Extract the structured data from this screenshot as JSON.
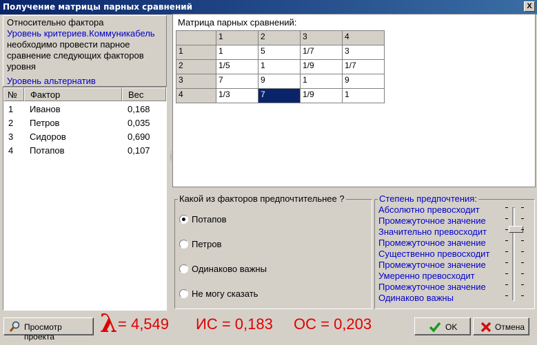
{
  "window": {
    "title": "Получение матрицы парных сравнений",
    "close_glyph": "X"
  },
  "info": {
    "line1": "Относительно фактора",
    "line2": "Уровень критериев.Коммуникабель",
    "line3": "необходимо провести парное",
    "line4": "сравнение следующих факторов",
    "line5": "уровня",
    "line6": "Уровень альтернатив"
  },
  "factors": {
    "headers": {
      "num": "№",
      "name": "Фактор",
      "weight": "Вес"
    },
    "rows": [
      {
        "num": "1",
        "name": "Иванов",
        "weight": "0,168"
      },
      {
        "num": "2",
        "name": "Петров",
        "weight": "0,035"
      },
      {
        "num": "3",
        "name": "Сидоров",
        "weight": "0,690"
      },
      {
        "num": "4",
        "name": "Потапов",
        "weight": "0,107"
      }
    ]
  },
  "matrix": {
    "label": "Матрица парных сравнений:",
    "col_headers": [
      "1",
      "2",
      "3",
      "4"
    ],
    "rows": [
      {
        "header": "1",
        "cells": [
          "1",
          "5",
          "1/7",
          "3"
        ]
      },
      {
        "header": "2",
        "cells": [
          "1/5",
          "1",
          "1/9",
          "1/7"
        ]
      },
      {
        "header": "3",
        "cells": [
          "7",
          "9",
          "1",
          "9"
        ]
      },
      {
        "header": "4",
        "cells": [
          "1/3",
          "7",
          "1/9",
          "1"
        ]
      }
    ],
    "selected_cell": {
      "row": 4,
      "col": 2
    }
  },
  "question": {
    "title": "Какой из факторов предпочтительнее ?",
    "options": [
      {
        "label": "Потапов",
        "checked": true
      },
      {
        "label": "Петров",
        "checked": false
      },
      {
        "label": "Одинаково важны",
        "checked": false
      },
      {
        "label": "Не могу сказать",
        "checked": false
      }
    ]
  },
  "degree": {
    "title": "Степень предпочтения:",
    "items": [
      "Абсолютно превосходит",
      "Промежуточное значение",
      "Значительно превосходит",
      "Промежуточное значение",
      "Существенно превосходит",
      "Промежуточное значение",
      "Умеренно превосходит",
      "Промежуточное значение",
      "Одинаково важны"
    ],
    "slider_level": 7
  },
  "footer": {
    "preview_button": "Просмотр проекта",
    "lambda_symbol": "λ",
    "lambda_value": "= 4,549",
    "is_text": "ИС = 0,183",
    "os_text": "ОС = 0,203",
    "ok_button": "OK",
    "cancel_button": "Отмена"
  },
  "colors": {
    "titlebar": "#0a246a",
    "accent_blue": "#0000cc",
    "stat_red": "#e00000",
    "selection": "#0a246a"
  }
}
